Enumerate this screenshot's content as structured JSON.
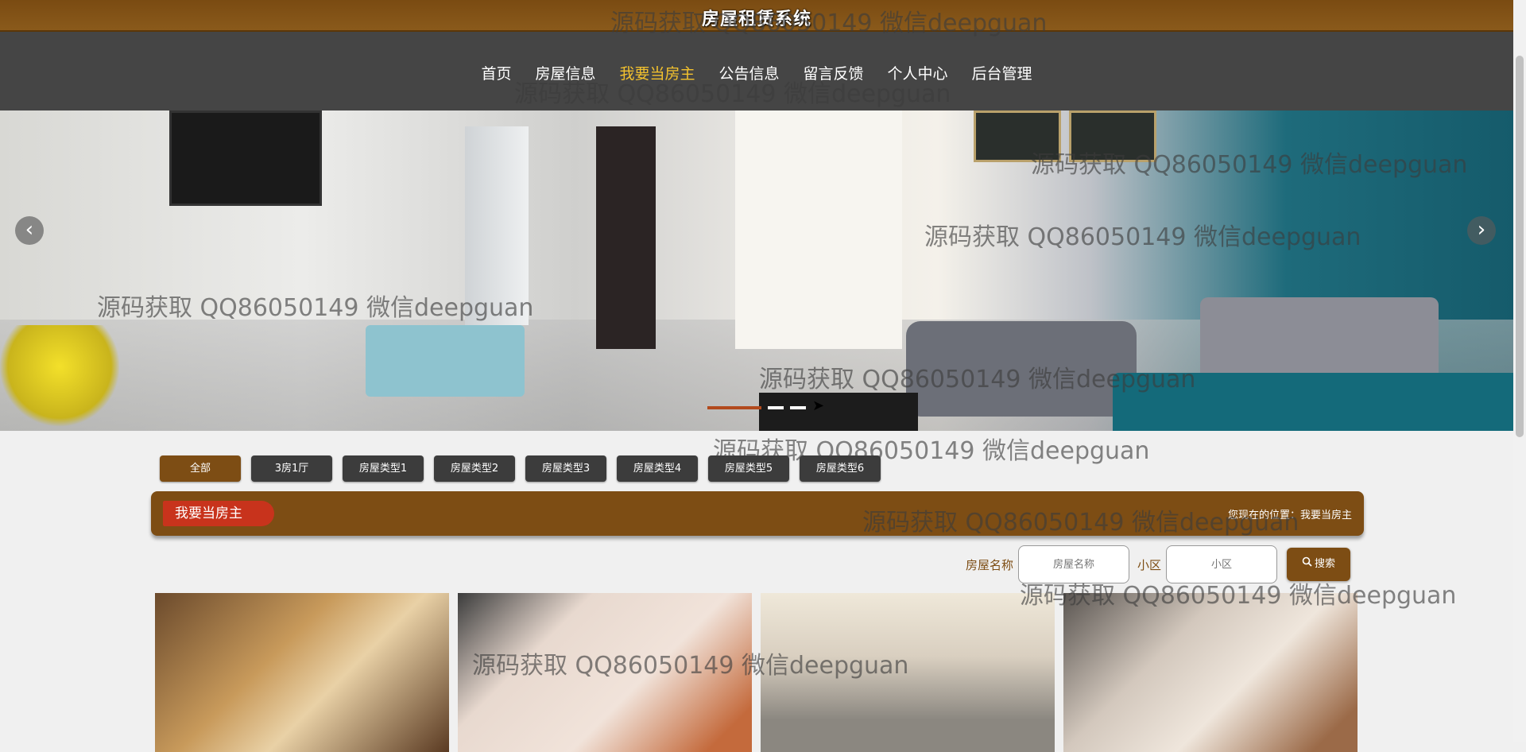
{
  "site_title": "房屋租赁系统",
  "nav": {
    "items": [
      {
        "label": "首页"
      },
      {
        "label": "房屋信息"
      },
      {
        "label": "我要当房主",
        "active": true
      },
      {
        "label": "公告信息"
      },
      {
        "label": "留言反馈"
      },
      {
        "label": "个人中心"
      },
      {
        "label": "后台管理"
      }
    ]
  },
  "banner": {
    "prev_icon": "chevron-left-icon",
    "next_icon": "chevron-right-icon",
    "prev_glyph": "‹",
    "next_glyph": "›",
    "slide_count": 3,
    "active_slide": 1
  },
  "filters": [
    {
      "label": "全部",
      "active": true
    },
    {
      "label": "3房1厅"
    },
    {
      "label": "房屋类型1"
    },
    {
      "label": "房屋类型2"
    },
    {
      "label": "房屋类型3"
    },
    {
      "label": "房屋类型4"
    },
    {
      "label": "房屋类型5"
    },
    {
      "label": "房屋类型6"
    }
  ],
  "section": {
    "title": "我要当房主",
    "breadcrumb": "您现在的位置：我要当房主"
  },
  "search": {
    "name_label": "房屋名称",
    "name_placeholder": "房屋名称",
    "community_label": "小区",
    "community_placeholder": "小区",
    "button_label": "搜索",
    "button_icon": "search-icon"
  },
  "colors": {
    "brand": "#7d4d14",
    "nav_bg": "#454545",
    "nav_active": "#f2c12e",
    "section_title_bg": "#c8331c"
  },
  "watermark": "源码获取 QQ86050149 微信deepguan"
}
